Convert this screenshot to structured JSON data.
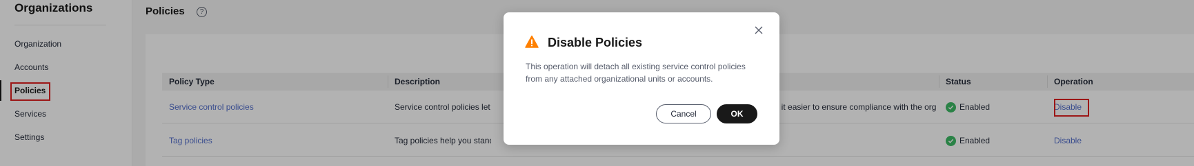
{
  "sidebar": {
    "title": "Organizations",
    "items": [
      {
        "label": "Organization"
      },
      {
        "label": "Accounts"
      },
      {
        "label": "Policies"
      },
      {
        "label": "Services"
      },
      {
        "label": "Settings"
      }
    ],
    "active_index": 2
  },
  "main": {
    "page_title": "Policies",
    "help_icon": "?",
    "table": {
      "columns": [
        "Policy Type",
        "Description",
        "Status",
        "Operation"
      ],
      "rows": [
        {
          "policy_type": "Service control policies",
          "description_left": "Service control policies let yo",
          "description_right": "This makes it easier to ensure compliance with the organiz...",
          "status": "Enabled",
          "operation": "Disable"
        },
        {
          "policy_type": "Tag policies",
          "description_left": "Tag policies help you standar",
          "description_right": "",
          "status": "Enabled",
          "operation": "Disable"
        }
      ]
    }
  },
  "modal": {
    "title": "Disable Policies",
    "body": "This operation will detach all existing service control policies from any attached organizational units or accounts.",
    "cancel_label": "Cancel",
    "ok_label": "OK",
    "icon": "warning-icon"
  },
  "colors": {
    "link": "#526ecc",
    "success": "#3dba65",
    "warning": "#ff8000",
    "highlight": "#e02020",
    "primary_button": "#191919"
  }
}
